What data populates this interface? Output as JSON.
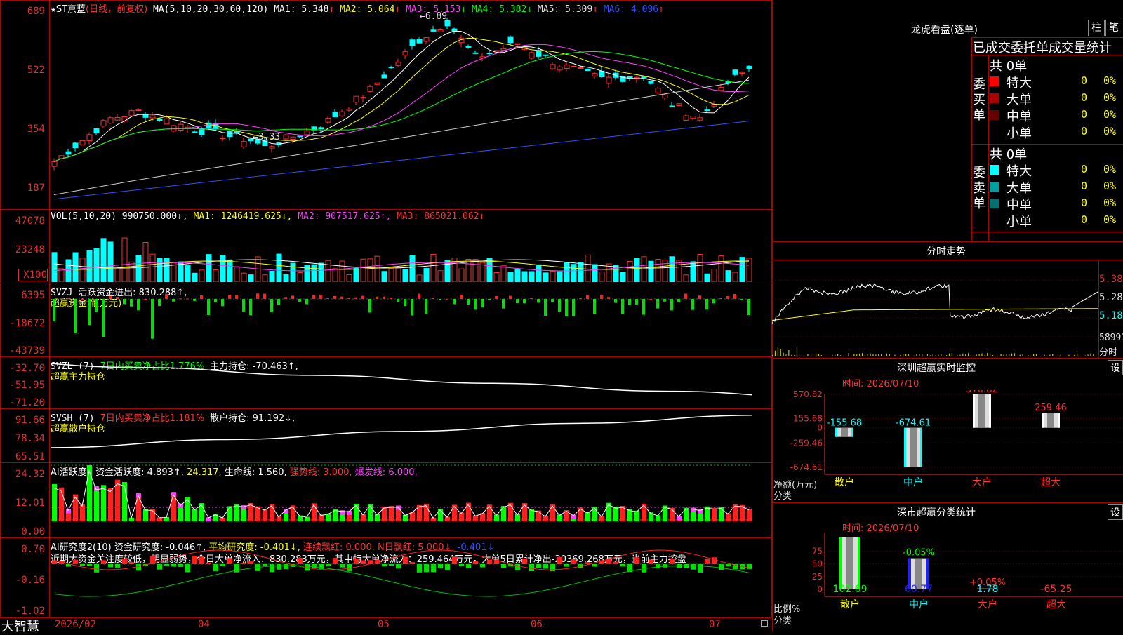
{
  "stock": {
    "name": "ST京蓝",
    "mode": "(日线，前复权)"
  },
  "main_header": {
    "ma_label": "MA(5,10,20,30,60,120)",
    "items": [
      {
        "label": "MA1:",
        "value": "5.348",
        "arrow": "↑",
        "color": "#ffffff"
      },
      {
        "label": "MA2:",
        "value": "5.064",
        "arrow": "↑",
        "color": "#ffff00"
      },
      {
        "label": "MA3:",
        "value": "5.153",
        "arrow": "↓",
        "color": "#ff40ff"
      },
      {
        "label": "MA4:",
        "value": "5.382",
        "arrow": "↓",
        "color": "#00ff00"
      },
      {
        "label": "MA5:",
        "value": "5.309",
        "arrow": "↑",
        "color": "#dddddd"
      },
      {
        "label": "MA6:",
        "value": "4.096",
        "arrow": "↑",
        "color": "#3050ff"
      }
    ],
    "high_label": "←6.89",
    "low_label": "←3.33"
  },
  "axes": {
    "price_ticks": [
      "689",
      "522",
      "354",
      "187"
    ],
    "vol_ticks": [
      "47078",
      "23248",
      "X100"
    ],
    "svzj_ticks": [
      "6395",
      "-18672",
      "-43739"
    ],
    "svzl_ticks": [
      "-32.70",
      "-51.95",
      "-71.20"
    ],
    "svsh_ticks": [
      "91.66",
      "78.34",
      "65.51"
    ],
    "ai_ticks": [
      "24.32",
      "12.01",
      "0.00"
    ],
    "ai2_ticks": [
      "0.70",
      "-0.16",
      "-1.02"
    ],
    "date_ticks": [
      "2026/02",
      "04",
      "05",
      "06",
      "07"
    ]
  },
  "vol_header": {
    "label": "VOL(5,10,20)",
    "value": "990750.000↓,",
    "ma1": "MA1: 1246419.625↓,",
    "ma2": "MA2: 907517.625↑,",
    "ma3": "MA3: 865021.062↑"
  },
  "svzj_header": {
    "label": "SVZJ",
    "text": "活跃资金进出: 830.288↑,",
    "sub": "超赢资金流(万元)"
  },
  "svzl_header": {
    "label": "SVZL (7)",
    "ratio": "7日内买卖净占比1.776%",
    "text": "主力持仓: -70.463↑,",
    "sub": "超赢主力持仓"
  },
  "svsh_header": {
    "label": "SVSH (7)",
    "ratio": "7日内买卖净占比1.181%",
    "text": "散户持仓: 91.192↓,",
    "sub": "超赢散户持仓"
  },
  "ai_header": {
    "label": "AI活跃度2",
    "t1": "资金活跃度: 4.893↑,",
    "t2": "24.317,",
    "t3": "生命线: 1.560,",
    "t4": "强势线: 3.000,",
    "t5": "爆发线: 6.000,"
  },
  "ai2_header": {
    "label": "AI研究度2(10)",
    "t1": "资金研究度: -0.046↑,",
    "t2": "平均研究度: -0.401↓,",
    "t3": "连续飘红: 0.000,",
    "t4": "N日飘红: 5.000↓,",
    "t5": "-0.401↓"
  },
  "ai2_note": "近期大资金关注度较低，明显弱势，今日大单净流入：830.283万元，其中特大单净流入：259.464万元，大单5日累计净出-20369.268万元，当前主力控盘",
  "brand": "大智慧",
  "right": {
    "dragon_title": "龙虎看盘(逐单)",
    "btn_zhu": "柱",
    "btn_bi": "笔",
    "order_title": "已成交委托单成交量统计",
    "buy_label": "委买单",
    "sell_label": "委卖单",
    "buy_total": "共 0单",
    "sell_total": "共 0单",
    "buy_rows": [
      {
        "name": "特大",
        "count": "0",
        "pct": "0%",
        "color": "#ff0000"
      },
      {
        "name": "大单",
        "count": "0",
        "pct": "0%",
        "color": "#aa0000"
      },
      {
        "name": "中单",
        "count": "0",
        "pct": "0%",
        "color": "#660000"
      },
      {
        "name": "小单",
        "count": "0",
        "pct": "0%",
        "color": "#000000"
      }
    ],
    "sell_rows": [
      {
        "name": "特大",
        "count": "0",
        "pct": "0%",
        "color": "#00ffff"
      },
      {
        "name": "大单",
        "count": "0",
        "pct": "0%",
        "color": "#00a0a0"
      },
      {
        "name": "中单",
        "count": "0",
        "pct": "0%",
        "color": "#007070"
      },
      {
        "name": "小单",
        "count": "0",
        "pct": "0%",
        "color": "#000000"
      }
    ],
    "intraday_title": "分时走势",
    "intraday_ticks": [
      "5.38",
      "5.28",
      "5.18"
    ],
    "intraday_vol": "58991",
    "intraday_vol_label": "分时",
    "sz_title": "深圳超赢实时监控",
    "sz_btn": "设",
    "sz_time": "时间: 2026/07/10",
    "sz_yticks": [
      "570.82",
      "155.68",
      "0",
      "-259.46",
      "-674.61"
    ],
    "sz_ylabel1": "净额(万元)",
    "sz_ylabel2": "分类",
    "sz_cats": [
      "散户",
      "中户",
      "大户",
      "超大"
    ],
    "sz_values": [
      -155.68,
      -674.61,
      570.82,
      259.46
    ],
    "sz_labels": [
      "-155.68",
      "-674.61",
      "570.82",
      "259.46"
    ],
    "cls_title": "深市超赢分类统计",
    "cls_btn": "设",
    "cls_time": "时间: 2026/07/10",
    "cls_yticks": [
      "75",
      "50",
      "25",
      "0"
    ],
    "cls_ylabel1": "比例%",
    "cls_ylabel2": "分类",
    "cls_cats": [
      "散户",
      "中户",
      "大户",
      "超大"
    ],
    "cls_values": [
      102.69,
      60.77,
      1.78,
      -65.25
    ],
    "cls_value_labels": [
      "102.69",
      "60.77",
      "1.78",
      "-65.25"
    ],
    "cls_top_labels": [
      "",
      "-0.05%",
      "+0.05%",
      ""
    ]
  },
  "chart_data": [
    {
      "type": "bar",
      "title": "深圳超赢实时监控",
      "ylabel": "净额(万元)",
      "categories": [
        "散户",
        "中户",
        "大户",
        "超大"
      ],
      "values": [
        -155.68,
        -674.61,
        570.82,
        259.46
      ],
      "ylim": [
        -674.61,
        570.82
      ]
    },
    {
      "type": "bar",
      "title": "深市超赢分类统计",
      "ylabel": "比例%",
      "categories": [
        "散户",
        "中户",
        "大户",
        "超大"
      ],
      "values": [
        102.69,
        60.77,
        1.78,
        -65.25
      ],
      "ylim": [
        0,
        75
      ]
    },
    {
      "type": "line",
      "title": "ST京蓝 (日线，前复权)",
      "x": [
        "2026/02",
        "04",
        "05",
        "06",
        "07"
      ],
      "ylim": [
        187,
        689
      ],
      "series": [
        {
          "name": "MA1",
          "values": [
            5.348
          ]
        },
        {
          "name": "MA2",
          "values": [
            5.064
          ]
        },
        {
          "name": "MA3",
          "values": [
            5.153
          ]
        },
        {
          "name": "MA4",
          "values": [
            5.382
          ]
        },
        {
          "name": "MA5",
          "values": [
            5.309
          ]
        },
        {
          "name": "MA6",
          "values": [
            4.096
          ]
        }
      ]
    }
  ]
}
